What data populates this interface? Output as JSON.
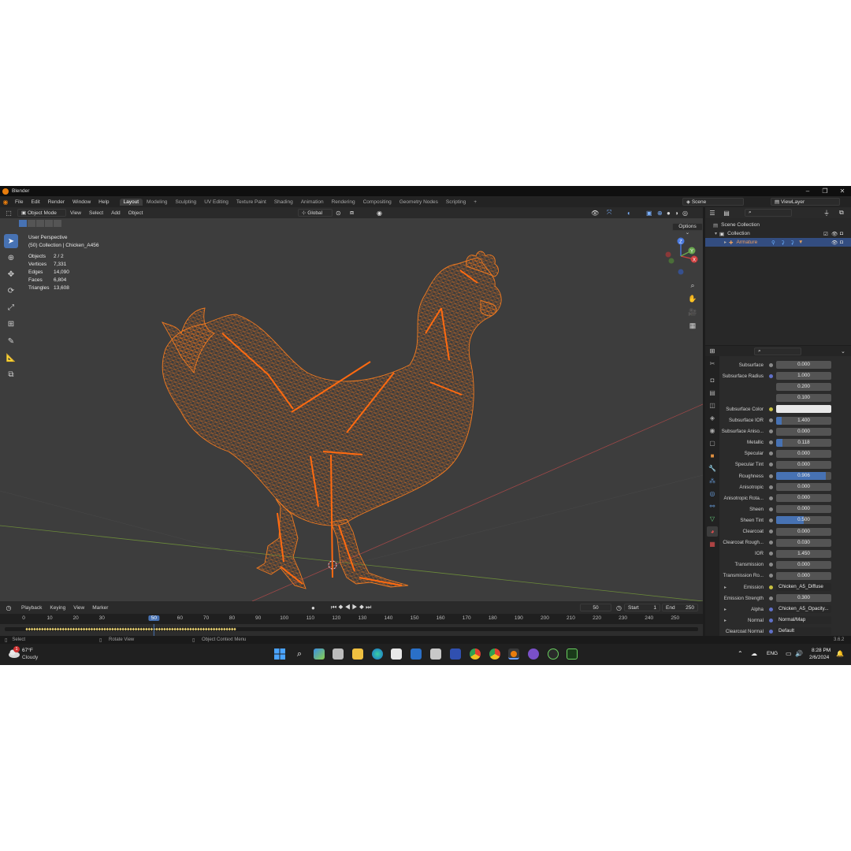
{
  "window": {
    "title": "Blender",
    "controls": [
      "–",
      "❐",
      "✕"
    ]
  },
  "menubar": {
    "menus": [
      "File",
      "Edit",
      "Render",
      "Window",
      "Help"
    ],
    "workspaces": [
      {
        "label": "Layout",
        "active": true
      },
      {
        "label": "Modeling"
      },
      {
        "label": "Sculpting"
      },
      {
        "label": "UV Editing"
      },
      {
        "label": "Texture Paint"
      },
      {
        "label": "Shading"
      },
      {
        "label": "Animation"
      },
      {
        "label": "Rendering"
      },
      {
        "label": "Compositing"
      },
      {
        "label": "Geometry Nodes"
      },
      {
        "label": "Scripting"
      }
    ],
    "add_tab": "+",
    "scene": "Scene",
    "view_layer": "ViewLayer"
  },
  "viewport_header": {
    "mode": "Object Mode",
    "menus": [
      "View",
      "Select",
      "Add",
      "Object"
    ],
    "transform_orientation": "Global",
    "options": "Options"
  },
  "viewport_overlay": {
    "perspective": "User Perspective",
    "collection_path": "(50) Collection | Chicken_A456",
    "stats": [
      {
        "label": "Objects",
        "value": "2 / 2"
      },
      {
        "label": "Vertices",
        "value": "7,331"
      },
      {
        "label": "Edges",
        "value": "14,090"
      },
      {
        "label": "Faces",
        "value": "6,804"
      },
      {
        "label": "Triangles",
        "value": "13,608"
      }
    ]
  },
  "gizmo": {
    "x": "X",
    "y": "Y",
    "z": "Z"
  },
  "timeline": {
    "menus": [
      "Playback",
      "Keying",
      "View",
      "Marker"
    ],
    "current_frame": "50",
    "start_label": "Start",
    "start": "1",
    "end_label": "End",
    "end": "250",
    "frames": [
      "0",
      "10",
      "20",
      "30",
      "50",
      "60",
      "70",
      "80",
      "90",
      "100",
      "110",
      "120",
      "130",
      "140",
      "150",
      "160",
      "170",
      "180",
      "190",
      "200",
      "210",
      "220",
      "230",
      "240",
      "250"
    ],
    "current_frame_marker": "50"
  },
  "statusbar": {
    "select": "Select",
    "rotate": "Rotate View",
    "context": "Object Context Menu",
    "version": "3.6.2"
  },
  "outliner": {
    "scene_collection": "Scene Collection",
    "collection": "Collection",
    "armature": "Armature"
  },
  "properties": {
    "rows": [
      {
        "label": "Subsurface",
        "value": "0.000",
        "fill": 0
      },
      {
        "label": "Subsurface Radius",
        "value": "1.000",
        "fill": 0
      },
      {
        "label": "",
        "value": "0.200",
        "fill": 0
      },
      {
        "label": "",
        "value": "0.100",
        "fill": 0
      },
      {
        "label": "Subsurface Color",
        "value": "",
        "fill": 0,
        "kind": "color"
      },
      {
        "label": "Subsurface IOR",
        "value": "1.400",
        "fill": 0.1
      },
      {
        "label": "Subsurface Aniso...",
        "value": "0.000",
        "fill": 0
      },
      {
        "label": "Metallic",
        "value": "0.118",
        "fill": 0.118
      },
      {
        "label": "Specular",
        "value": "0.000",
        "fill": 0
      },
      {
        "label": "Specular Tint",
        "value": "0.000",
        "fill": 0
      },
      {
        "label": "Roughness",
        "value": "0.906",
        "fill": 0.906
      },
      {
        "label": "Anisotropic",
        "value": "0.000",
        "fill": 0
      },
      {
        "label": "Anisotropic Rota...",
        "value": "0.000",
        "fill": 0
      },
      {
        "label": "Sheen",
        "value": "0.000",
        "fill": 0
      },
      {
        "label": "Sheen Tint",
        "value": "0.500",
        "fill": 0.5
      },
      {
        "label": "Clearcoat",
        "value": "0.000",
        "fill": 0
      },
      {
        "label": "Clearcoat Rough...",
        "value": "0.030",
        "fill": 0
      },
      {
        "label": "IOR",
        "value": "1.450",
        "fill": 0
      },
      {
        "label": "Transmission",
        "value": "0.000",
        "fill": 0
      },
      {
        "label": "Transmission Ro...",
        "value": "0.000",
        "fill": 0
      },
      {
        "label": "Emission",
        "value": "Chicken_A5_Diffuse",
        "kind": "link",
        "expand": true
      },
      {
        "label": "Emission Strength",
        "value": "0.300",
        "fill": 0
      },
      {
        "label": "Alpha",
        "value": "Chicken_A5_Opacity...",
        "kind": "link",
        "expand": true
      },
      {
        "label": "Normal",
        "value": "Normal/Map",
        "kind": "link",
        "expand": true
      },
      {
        "label": "Clearcoat Normal",
        "value": "Default",
        "kind": "link"
      }
    ]
  },
  "taskbar": {
    "weather_temp": "67°F",
    "weather_desc": "Cloudy",
    "weather_badge": "1",
    "lang": "ENG",
    "time": "8:28 PM",
    "date": "2/6/2024"
  },
  "colors": {
    "accent": "#4772b3",
    "wireframe": "#e8731c",
    "bones": "#ff6a10",
    "viewport_bg": "#3d3d3d"
  }
}
